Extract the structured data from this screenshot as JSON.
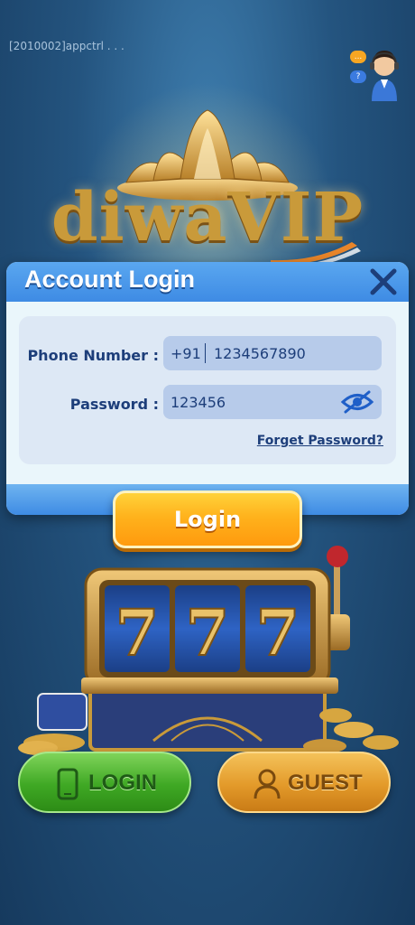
{
  "status": {
    "debug_text": "[2010002]appctrl . . ."
  },
  "support": {
    "icon": "customer-support-icon",
    "bubble_top": "...",
    "bubble_bottom": "?"
  },
  "logo": {
    "text": "diwaVIP",
    "icon": "lotus-icon"
  },
  "dialog": {
    "title": "Account Login",
    "close_icon": "close-icon",
    "phone_label": "Phone Number :",
    "phone_prefix": "+91",
    "phone_value": "1234567890",
    "password_label": "Password :",
    "password_value": "123456",
    "eye_icon": "eye-hidden-icon",
    "forget_link": "Forget Password?"
  },
  "login_button": {
    "label": "Login"
  },
  "slot_machine": {
    "reels": [
      "7",
      "7",
      "7"
    ]
  },
  "bottom_buttons": {
    "login": {
      "label": "LOGIN",
      "icon": "phone-icon"
    },
    "guest": {
      "label": "GUEST",
      "icon": "user-icon"
    }
  },
  "colors": {
    "background": "#24547f",
    "dialog_header": "#3e8be4",
    "login_orange": "#ffb21c",
    "green_button": "#3fa824",
    "gold_button": "#e39a2a",
    "label_text": "#1d3e7a"
  }
}
